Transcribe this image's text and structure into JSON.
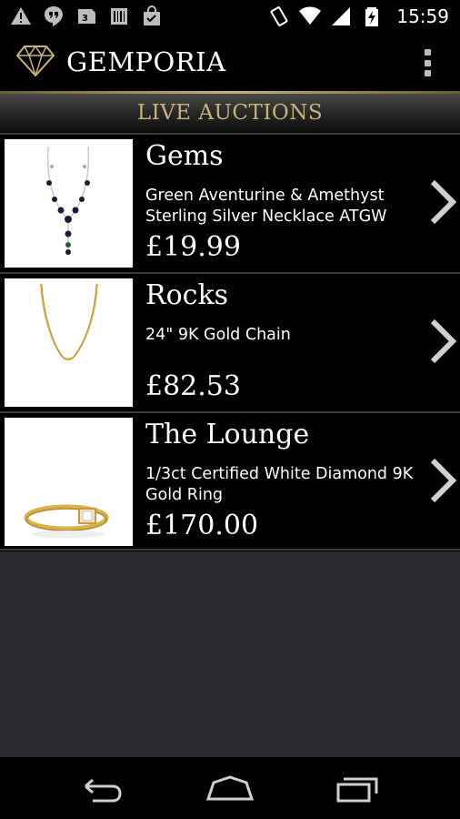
{
  "status_bar": {
    "left_icons": [
      "alert-icon",
      "hangouts-icon",
      "sim-3g-icon",
      "barcode-icon",
      "shopping-bag-icon"
    ],
    "right_icons": [
      "vibrate-icon",
      "wifi-icon",
      "signal-icon",
      "battery-charging-icon"
    ],
    "time": "15:59"
  },
  "action_bar": {
    "title": "GEMPORIA",
    "logo_icon": "diamond-logo-icon",
    "menu_icon": "overflow-menu-icon"
  },
  "section": {
    "title": "LIVE AUCTIONS"
  },
  "auctions": [
    {
      "category": "Gems",
      "description": "Green Aventurine & Amethyst Sterling Silver Necklace  ATGW",
      "price": "£19.99",
      "image": "necklace-image"
    },
    {
      "category": "Rocks",
      "description": "24\" 9K Gold Chain",
      "price": "£82.53",
      "image": "gold-chain-image"
    },
    {
      "category": "The Lounge",
      "description": "1/3ct Certified White Diamond 9K Gold Ring",
      "price": "£170.00",
      "image": "diamond-ring-image"
    }
  ],
  "nav_bar": {
    "back_icon": "back-icon",
    "home_icon": "home-icon",
    "recents_icon": "recents-icon"
  },
  "colors": {
    "accent_gold": "#c8b27a",
    "background": "#000000",
    "empty_area": "#2a2c30",
    "divider": "#3a3a3a"
  }
}
